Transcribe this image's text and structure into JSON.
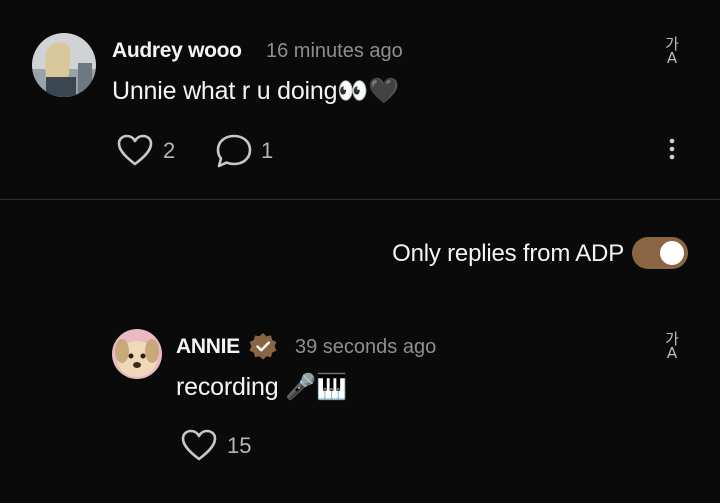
{
  "comment": {
    "author": "Audrey wooo",
    "time": "16 minutes ago",
    "text": "Unnie what r u doing👀🖤",
    "likes": "2",
    "replies": "1"
  },
  "filter": {
    "label": "Only replies from ADP",
    "enabled": true
  },
  "reply": {
    "author": "ANNIE",
    "time": "39 seconds ago",
    "text": "recording 🎤🎹",
    "likes": "15"
  },
  "colors": {
    "background": "#0a0a0a",
    "toggle_on": "#8a6544",
    "verified_badge": "#8a6544"
  },
  "icons": {
    "like": "heart-outline-icon",
    "reply": "speech-bubble-icon",
    "more": "vertical-dots-icon",
    "translate": "translate-icon",
    "verified": "verified-badge-icon"
  }
}
